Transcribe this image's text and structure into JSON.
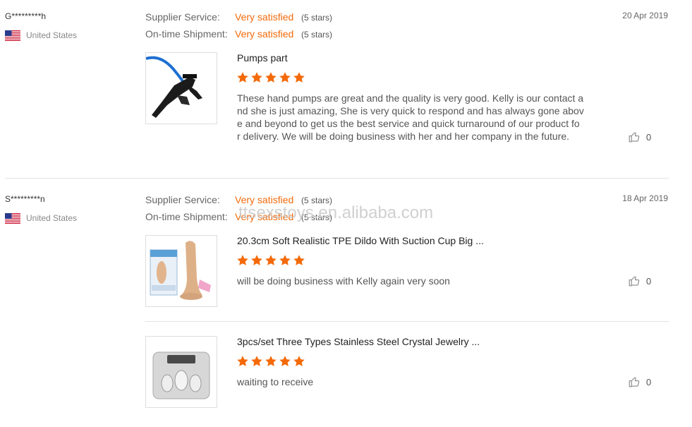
{
  "labels": {
    "supplier_service": "Supplier Service:",
    "ontime_shipment": "On-time Shipment:"
  },
  "colors": {
    "accent": "#f46a0a",
    "star": "#f46a0a"
  },
  "reviews": [
    {
      "buyer": "G*********h",
      "country": "United States",
      "supplier_service_value": "Very satisfied",
      "supplier_service_stars": "(5 stars)",
      "ontime_value": "Very satisfied",
      "ontime_stars": "(5 stars)",
      "date": "20 Apr 2019",
      "products": [
        {
          "title": "Pumps part",
          "rating": 5,
          "comment_lines": [
            "These hand pumps are great and the quality is very good. Kelly is our contact a",
            "nd she is just amazing, She is very quick to respond and has always gone abov",
            "e and beyond to get us the best service and quick turnaround of our product fo",
            "r delivery. We will be doing business with her and her company in the future."
          ],
          "likes": "0"
        }
      ]
    },
    {
      "buyer": "S*********n",
      "country": "United States",
      "supplier_service_value": "Very satisfied",
      "supplier_service_stars": "(5 stars)",
      "ontime_value": "Very satisfied",
      "ontime_stars": "(5 stars)",
      "date": "18 Apr 2019",
      "products": [
        {
          "title": "20.3cm Soft Realistic TPE Dildo With Suction Cup Big ...",
          "rating": 5,
          "comment": "will be doing business with Kelly again very soon",
          "likes": "0"
        },
        {
          "title": "3pcs/set Three Types Stainless Steel Crystal Jewelry ...",
          "rating": 5,
          "comment": "waiting to receive",
          "likes": "0"
        }
      ]
    }
  ],
  "watermark": "ttsexstoys.en.alibaba.com"
}
